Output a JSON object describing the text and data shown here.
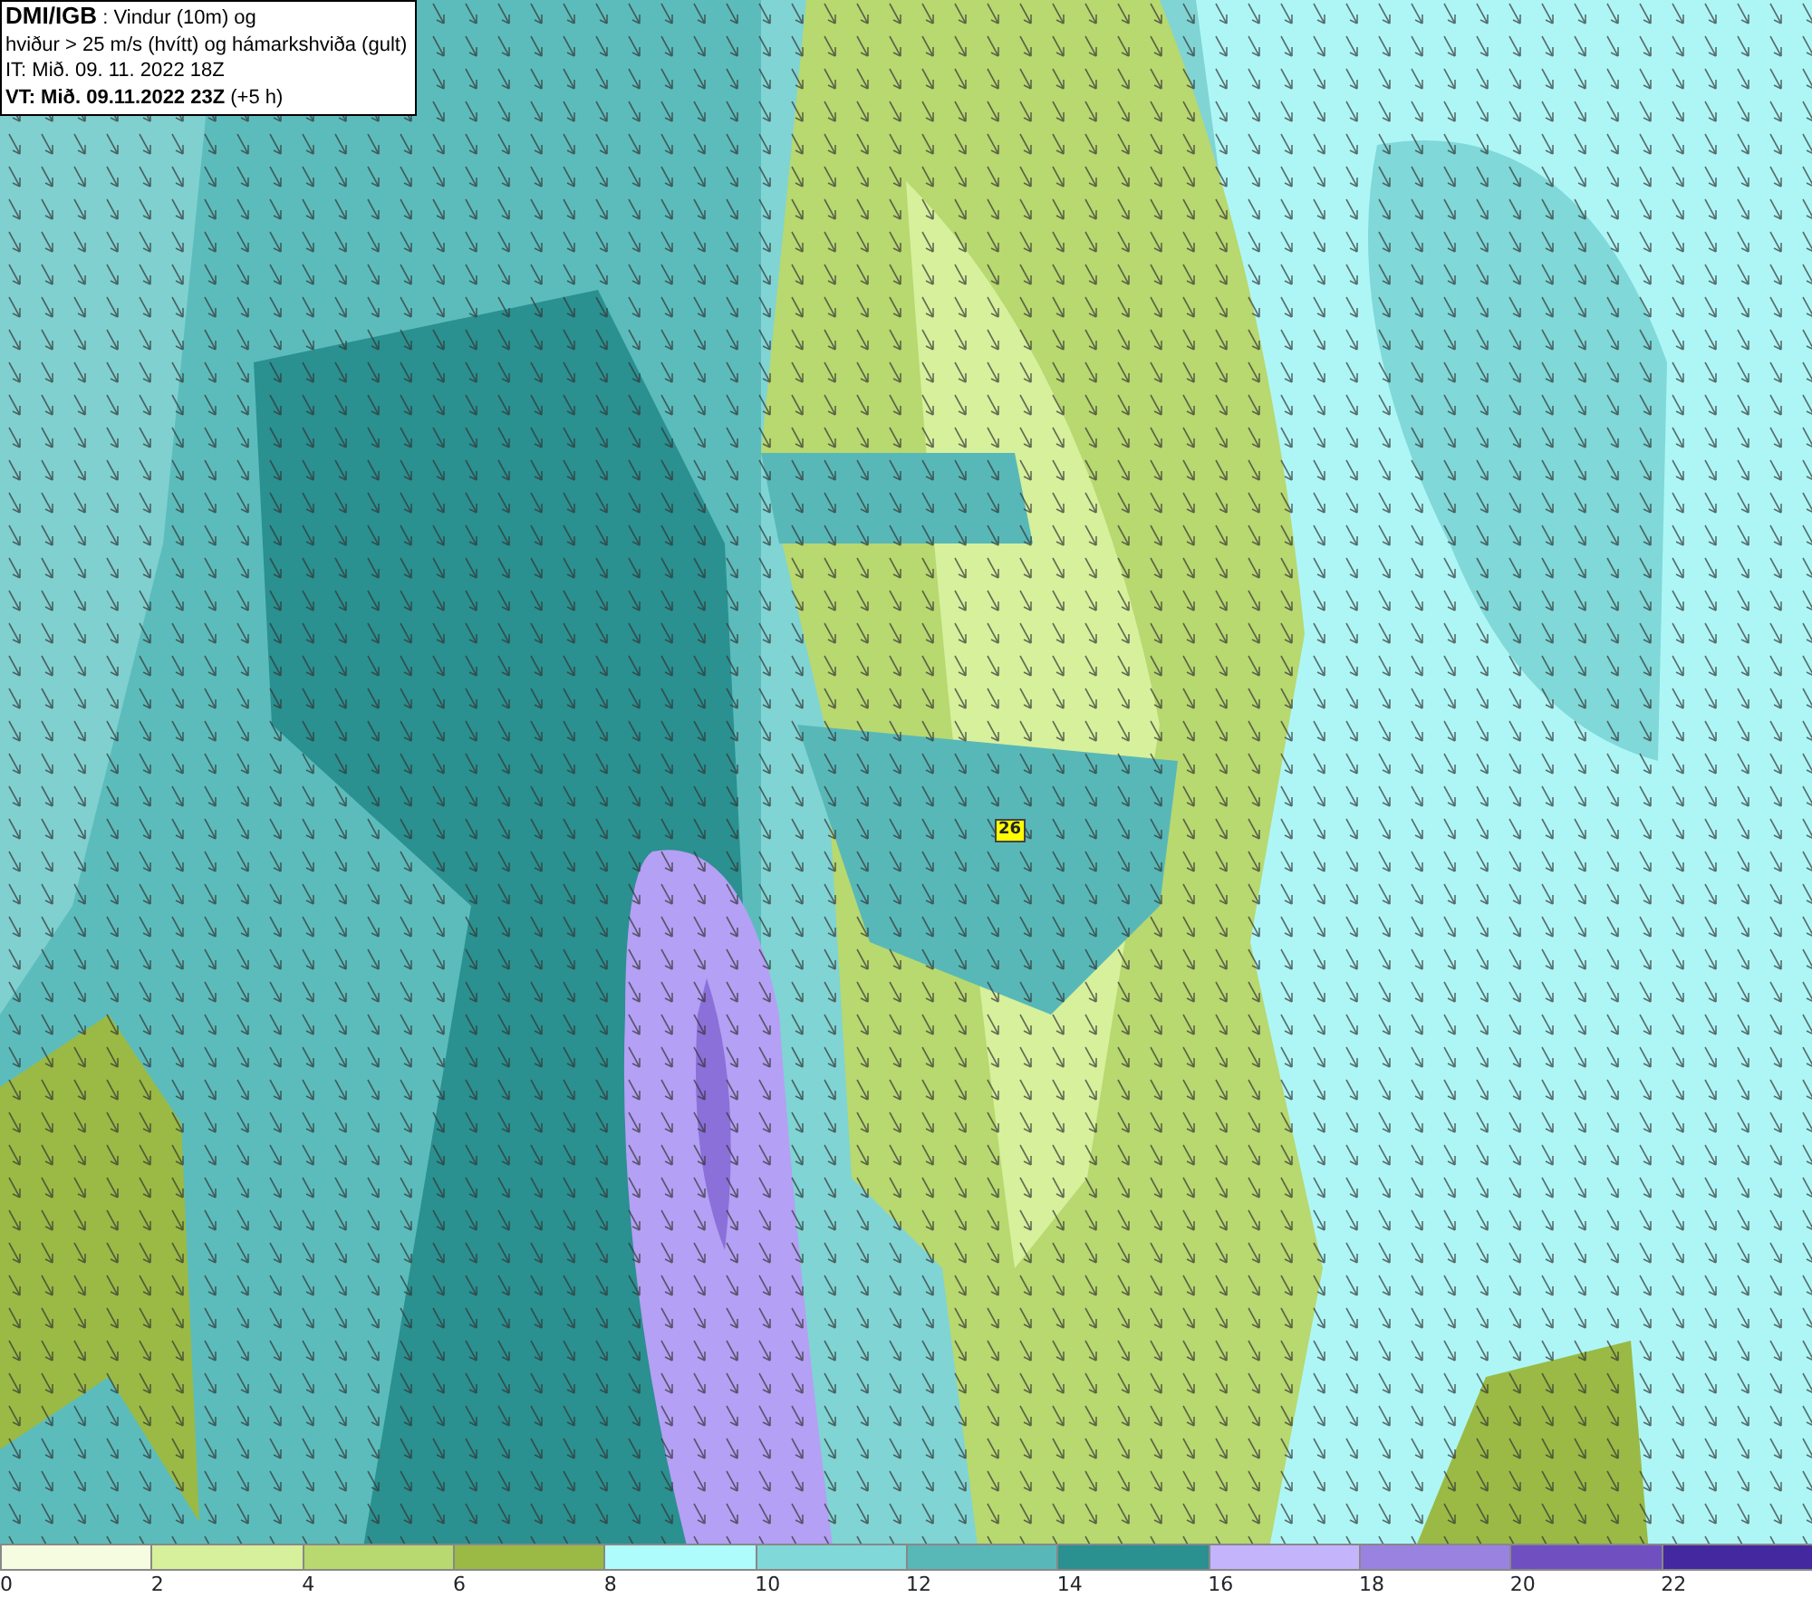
{
  "header": {
    "lines": [
      "**DMI/IGB** : Vindur (10m) og",
      "hviður > 25 m/s (hvítt) og hámarkshviða (gult)",
      "IT: Mið. 09. 11. 2022 18Z",
      "**VT: Mið. 09.11.2022 23Z** (+5 h)"
    ]
  },
  "map": {
    "gust_marker": {
      "label": "26",
      "color": "#ffff00"
    }
  },
  "legend": {
    "bins": [
      {
        "color": "#f5fce0"
      },
      {
        "color": "#d6f09c"
      },
      {
        "color": "#b8d870"
      },
      {
        "color": "#9aba45"
      },
      {
        "color": "#aefcfc"
      },
      {
        "color": "#80d8d8"
      },
      {
        "color": "#58b8b8"
      },
      {
        "color": "#2a9090"
      },
      {
        "color": "#c4b4fc"
      },
      {
        "color": "#9a82e0"
      },
      {
        "color": "#7050c0"
      },
      {
        "color": "#4428a0"
      }
    ],
    "ticks": [
      "0",
      "2",
      "4",
      "6",
      "8",
      "10",
      "12",
      "14",
      "16",
      "18",
      "20",
      "22"
    ]
  }
}
